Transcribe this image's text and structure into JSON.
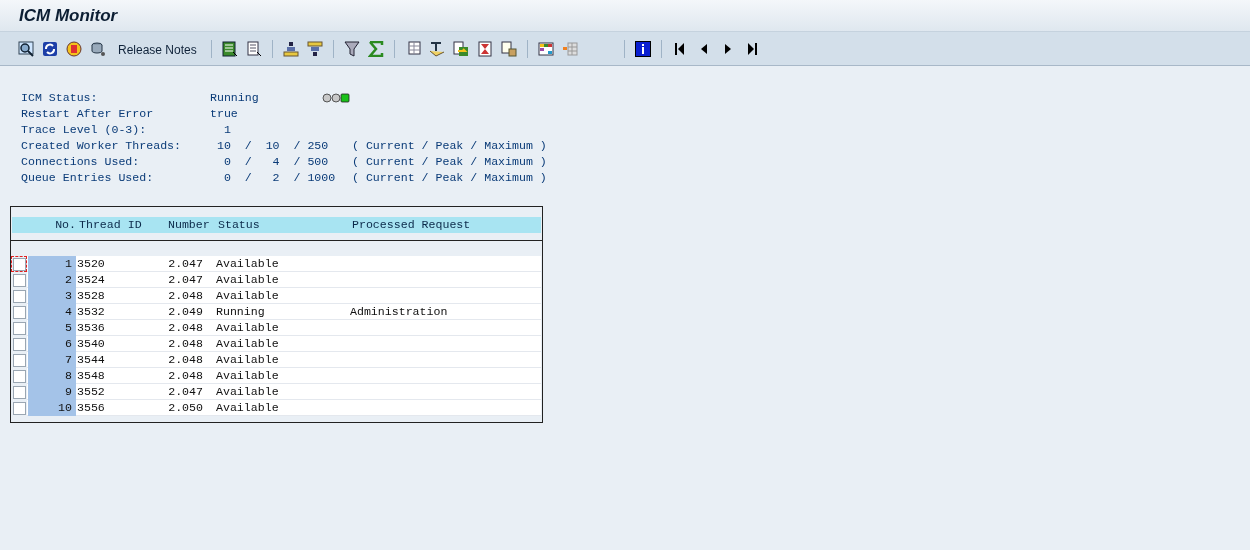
{
  "window": {
    "title": "ICM Monitor"
  },
  "toolbar": {
    "release_notes": "Release Notes"
  },
  "status": {
    "traffic_light": [
      {
        "on": false
      },
      {
        "on": false
      },
      {
        "on": true
      }
    ],
    "lines": [
      {
        "label": "ICM Status:",
        "value": "Running"
      },
      {
        "label": "Restart After Error",
        "value": "true"
      },
      {
        "label": "Trace Level (0-3):",
        "value": "  1"
      },
      {
        "label": "Created Worker Threads:",
        "value": " 10  /  10  / 250",
        "note": "( Current / Peak / Maximum )"
      },
      {
        "label": "Connections Used:",
        "value": "  0  /   4  / 500",
        "note": "( Current / Peak / Maximum )"
      },
      {
        "label": "Queue Entries Used:",
        "value": "  0  /   2  / 1000",
        "note": "( Current / Peak / Maximum )"
      }
    ]
  },
  "table": {
    "columns": [
      "No.",
      "Thread ID",
      "Number",
      "Status",
      "Processed Request"
    ],
    "rows": [
      {
        "no": "1",
        "thread_id": "3520",
        "number": "2.047",
        "status": "Available",
        "checked": false,
        "focused": true
      },
      {
        "no": "2",
        "thread_id": "3524",
        "number": "2.047",
        "status": "Available",
        "checked": false,
        "focused": false
      },
      {
        "no": "3",
        "thread_id": "3528",
        "number": "2.048",
        "status": "Available",
        "checked": false,
        "focused": false
      },
      {
        "no": "4",
        "thread_id": "3532",
        "number": "2.049",
        "status": "Running",
        "request": "Administration",
        "checked": false,
        "focused": false
      },
      {
        "no": "5",
        "thread_id": "3536",
        "number": "2.048",
        "status": "Available",
        "checked": false,
        "focused": false
      },
      {
        "no": "6",
        "thread_id": "3540",
        "number": "2.048",
        "status": "Available",
        "checked": false,
        "focused": false
      },
      {
        "no": "7",
        "thread_id": "3544",
        "number": "2.048",
        "status": "Available",
        "checked": false,
        "focused": false
      },
      {
        "no": "8",
        "thread_id": "3548",
        "number": "2.048",
        "status": "Available",
        "checked": false,
        "focused": false
      },
      {
        "no": "9",
        "thread_id": "3552",
        "number": "2.047",
        "status": "Available",
        "checked": false,
        "focused": false
      },
      {
        "no": "10",
        "thread_id": "3556",
        "number": "2.050",
        "status": "Available",
        "checked": false,
        "focused": false
      }
    ]
  }
}
